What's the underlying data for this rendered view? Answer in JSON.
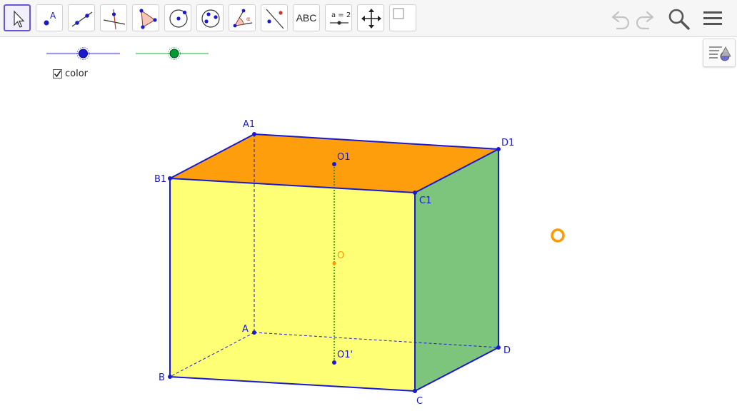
{
  "toolbar": {
    "tools": [
      {
        "name": "move-tool",
        "label": ""
      },
      {
        "name": "point-tool",
        "label": "A"
      },
      {
        "name": "line-tool",
        "label": ""
      },
      {
        "name": "perpendicular-line-tool",
        "label": ""
      },
      {
        "name": "polygon-tool",
        "label": ""
      },
      {
        "name": "circle-tool",
        "label": ""
      },
      {
        "name": "ellipse-tool",
        "label": ""
      },
      {
        "name": "angle-tool",
        "label": ""
      },
      {
        "name": "reflect-tool",
        "label": ""
      },
      {
        "name": "text-tool",
        "label": "ABC"
      },
      {
        "name": "slider-tool",
        "label": "a = 2"
      },
      {
        "name": "move-graphics-view-tool",
        "label": ""
      },
      {
        "name": "checkbox-tool",
        "label": ""
      }
    ],
    "right_icons": [
      "undo-icon",
      "redo-icon",
      "search-icon",
      "menu-icon"
    ]
  },
  "sliders": [
    {
      "name": "blue-slider",
      "color": "#1a1acd",
      "track_color": "#9b9be6",
      "value": 0.5
    },
    {
      "name": "green-slider",
      "color": "#009933",
      "track_color": "#8fd69f",
      "value": 0.53
    }
  ],
  "checkbox": {
    "label": "color",
    "checked": true
  },
  "points": {
    "A1": "A1",
    "B1": "B1",
    "C1": "C1",
    "D1": "D1",
    "A": "A",
    "B": "B",
    "C": "C",
    "D": "D",
    "O1": "O1",
    "O": "O",
    "O1p": "O1'"
  },
  "colors": {
    "top_face": "#ff9900",
    "front_face": "#ffff66",
    "right_face": "#66bb66",
    "edge": "#1a1acd",
    "axis": "#008800",
    "center_point": "#ff9900"
  }
}
